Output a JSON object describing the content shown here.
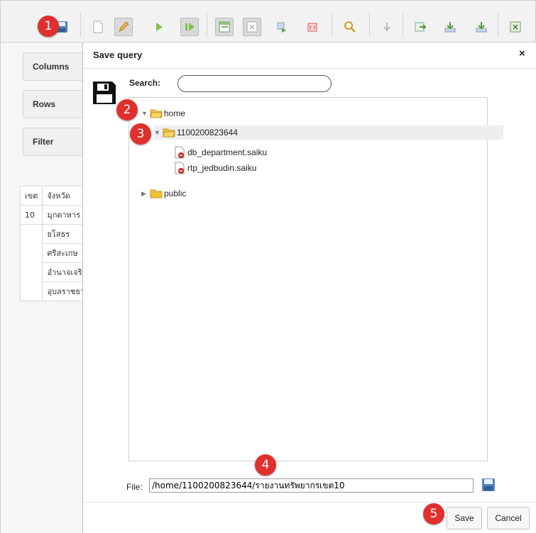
{
  "dialog": {
    "title": "Save query",
    "close_glyph": "×",
    "search_label": "Search:",
    "search_value": "",
    "file_label": "File:",
    "file_value": "/home/1100200823644/รายงานทรัพยากรเขต10",
    "save_label": "Save",
    "cancel_label": "Cancel"
  },
  "tree": {
    "root": "home",
    "user_folder": "1100200823644",
    "files": [
      "db_department.saiku",
      "rtp_jedbudin.saiku"
    ],
    "public": "public"
  },
  "workspace": {
    "columns_label": "Columns",
    "rows_label": "Rows",
    "filter_label": "Filter",
    "table": {
      "headers": [
        "เขต",
        "จังหวัด"
      ],
      "region": "10",
      "provinces": [
        "มุกดาหาร",
        "ยโสธร",
        "ศรีสะเกษ",
        "อำนาจเจริญ",
        "อุบลราชธานี"
      ]
    }
  },
  "badges": [
    "1",
    "2",
    "3",
    "4",
    "5"
  ],
  "colors": {
    "badge": "#e0302d",
    "folder": "#f2c037",
    "toolbar_bg": "#f2f2f2"
  },
  "icons": {
    "toolbar": [
      "open-icon",
      "save-icon",
      "new-query-icon",
      "edit-icon",
      "run-icon",
      "auto-run-icon",
      "toggle-fields-icon",
      "non-empty-icon",
      "swap-axis-icon",
      "mdx-icon",
      "explain-icon",
      "zoom-icon",
      "drillthrough-icon",
      "export-xls-icon",
      "export-csv-icon",
      "export-pdf-icon",
      "excel-icon"
    ]
  }
}
